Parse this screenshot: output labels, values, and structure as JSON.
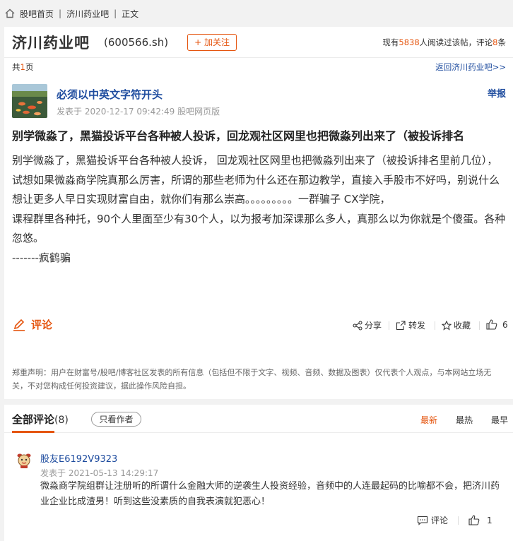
{
  "breadcrumb": {
    "home": "股吧首页",
    "bar": "济川药业吧",
    "current": "正文",
    "separator": "|"
  },
  "header": {
    "stock_name": "济川药业吧",
    "stock_code": "(600566.sh)",
    "follow_label": "+ 加关注",
    "read_prefix": "现有",
    "read_count": "5838",
    "read_suffix": "人阅读过该帖，评论",
    "comment_count": "8",
    "comment_suffix": "条"
  },
  "pagination": {
    "prefix": "共",
    "pages": "1",
    "suffix": "页",
    "back_label": "返回济川药业吧>>"
  },
  "post": {
    "author": "必须以中英文字符开头",
    "meta": "发表于 2020-12-17 09:42:49 股吧网页版",
    "report_label": "举报",
    "title": "别学微淼了，黑猫投诉平台各种被人投诉，回龙观社区网里也把微淼列出来了（被投诉排名",
    "body": [
      "别学微淼了，黑猫投诉平台各种被人投诉， 回龙观社区网里也把微淼列出来了（被投诉排名里前几位），试想如果微淼商学院真那么厉害，所谓的那些老师为什么还在那边教学，直接入手股市不好吗，别说什么想让更多人早日实现财富自由，就你们有那么崇高。。。。。。。。。一群骗子 CX学院，",
      "课程群里各种托，90个人里面至少有30个人，以为报考加深课那么多人，真那么以为你就是个傻蛋。各种忽悠。",
      "-------疯鹤骗"
    ]
  },
  "actions": {
    "comment_label": "评论",
    "share_label": "分享",
    "forward_label": "转发",
    "collect_label": "收藏",
    "like_count": "6"
  },
  "disclaimer": "郑重声明：用户在财富号/股吧/博客社区发表的所有信息（包括但不限于文字、视频、音频、数据及图表）仅代表个人观点，与本网站立场无关，不对您构成任何投资建议，据此操作风险自担。",
  "comments_section": {
    "tab_label": "全部评论",
    "tab_count": "(8)",
    "only_author_label": "只看作者",
    "sort_options": [
      "最新",
      "最热",
      "最早"
    ],
    "items": [
      {
        "user": "股友E6192V9323",
        "time": "发表于 2021-05-13 14:29:17",
        "text": "微淼商学院组群让注册听的所谓什么金融大师的逆袭生人投资经验，音频中的人连最起码的比喻都不会，把济川药业企业比成渣男！听到这些没素质的自我表演就犯恶心！",
        "reply_label": "评论",
        "likes": "1"
      }
    ]
  },
  "colors": {
    "accent": "#e5550f",
    "link": "#1d4b9e",
    "muted": "#999999"
  }
}
